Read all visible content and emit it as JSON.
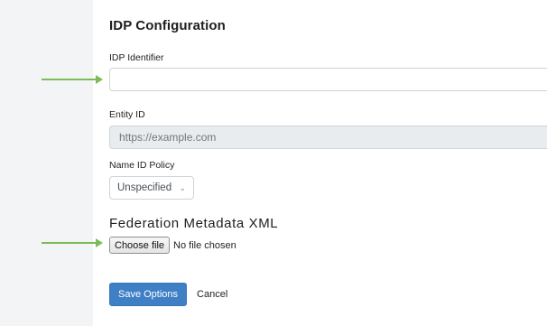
{
  "form": {
    "title": "IDP Configuration",
    "idp_identifier": {
      "label": "IDP Identifier",
      "value": ""
    },
    "entity_id": {
      "label": "Entity ID",
      "placeholder": "https://example.com"
    },
    "name_id_policy": {
      "label": "Name ID Policy",
      "selected": "Unspecified"
    },
    "metadata": {
      "heading": "Federation Metadata XML",
      "choose_label": "Choose file",
      "file_status": "No file chosen"
    },
    "actions": {
      "save_label": "Save Options",
      "cancel_label": "Cancel"
    }
  },
  "colors": {
    "primary": "#3f7fc6",
    "annotation_arrow": "#7dbb57",
    "gutter": "#f3f4f6"
  }
}
